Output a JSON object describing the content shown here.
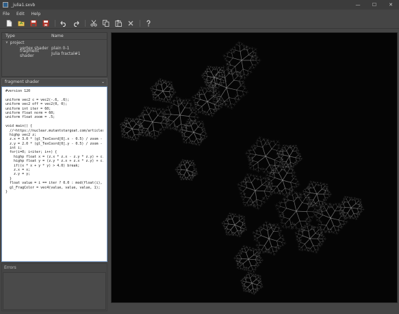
{
  "window": {
    "title": "_julia1.sxvb",
    "controls": {
      "minimize": "—",
      "maximize": "☐",
      "close": "✕"
    }
  },
  "menu": [
    "File",
    "Edit",
    "Help"
  ],
  "toolbar": {
    "icons": [
      "new-file-icon",
      "open-file-icon",
      "save-icon",
      "save-as-icon",
      "undo-icon",
      "redo-icon",
      "cut-icon",
      "copy-icon",
      "paste-icon",
      "delete-icon",
      "help-icon"
    ]
  },
  "project_tree": {
    "columns": [
      "Type",
      "Name"
    ],
    "root": {
      "toggle": "∨",
      "label": "project"
    },
    "items": [
      {
        "type": "vertex shader",
        "name": "plain 0-1"
      },
      {
        "type": "fragment shader",
        "name": "Julia fractal#1"
      }
    ]
  },
  "editor": {
    "selected": "fragment shader",
    "code_lines": [
      "#version 120",
      "",
      "uniform vec2 c = vec2(-.6, .6);",
      "uniform vec2 off = vec2(0, 0);",
      "uniform int iter = 60;",
      "uniform float norm = 60;",
      "uniform float zoom = .5;",
      "",
      "void main() {",
      "  //~https://nuclear.mutantstargoat.com/articles/sdr_fract/",
      "  highp vec2 z;",
      "  z.x = 3.0 * (gl_TexCoord[0].x - 0.5) / zoom - off.x;",
      "  z.y = 2.0 * (gl_TexCoord[0].y - 0.5) / zoom - off.y;",
      "  int i;",
      "  for(i=0; i<iter; i++) {",
      "    highp float x = (z.x * z.x - z.y * z.y) + c.x;",
      "    highp float y = (z.y * z.x + z.x * z.y) + c.y;",
      "    if((x * x + y * y) > 4.0) break;",
      "    z.x = x;",
      "    z.y = y;",
      "  }",
      "  float value = i == iter ? 0.0 : mod(float(i), norm, 1.);",
      "  gl_FragColor = vec4(value, value, value, 1);",
      "}"
    ]
  },
  "errors": {
    "label": "Errors"
  },
  "render": {
    "description_icon": "julia-fractal-render"
  }
}
